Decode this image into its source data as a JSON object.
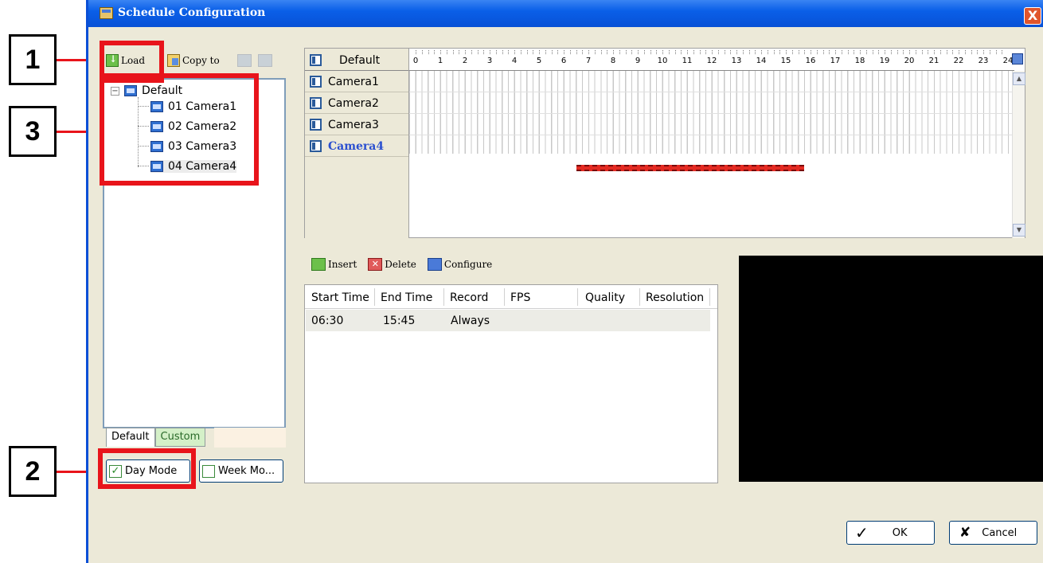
{
  "window": {
    "title": "Schedule Configuration",
    "close_label": "X"
  },
  "toolbar": {
    "load": "Load",
    "copy_to": "Copy to"
  },
  "tree": {
    "root": "Default",
    "items": [
      "01 Camera1",
      "02 Camera2",
      "03 Camera3",
      "04 Camera4"
    ]
  },
  "tabs": {
    "default": "Default",
    "custom": "Custom"
  },
  "modes": {
    "day": "Day Mode",
    "week": "Week Mo..."
  },
  "schedule": {
    "header": "Default",
    "rows": [
      "Camera1",
      "Camera2",
      "Camera3",
      "Camera4"
    ],
    "selected_row": "Camera4",
    "hours": [
      "0",
      "1",
      "2",
      "3",
      "4",
      "5",
      "6",
      "7",
      "8",
      "9",
      "10",
      "11",
      "12",
      "13",
      "14",
      "15",
      "16",
      "17",
      "18",
      "19",
      "20",
      "21",
      "22",
      "23",
      "24"
    ],
    "bar": {
      "camera": "Camera4",
      "start": "06:30",
      "end": "15:45",
      "color": "#e32a22"
    }
  },
  "actions": {
    "insert": "Insert",
    "delete": "Delete",
    "configure": "Configure"
  },
  "table": {
    "headers": [
      "Start Time",
      "End Time",
      "Record",
      "FPS",
      "Quality",
      "Resolution"
    ],
    "rows": [
      {
        "start": "06:30",
        "end": "15:45",
        "record": "Always",
        "fps": "",
        "quality": "",
        "resolution": ""
      }
    ]
  },
  "buttons": {
    "ok": "OK",
    "cancel": "Cancel"
  },
  "callouts": {
    "c1": "1",
    "c2": "2",
    "c3": "3"
  },
  "colors": {
    "titlebar": "#0a5fe8",
    "highlight": "#e8141b",
    "selected_text": "#2a4fd0"
  }
}
